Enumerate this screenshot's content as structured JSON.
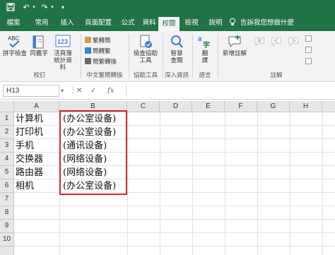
{
  "tabs": [
    "檔案",
    "常用",
    "插入",
    "頁面配置",
    "公式",
    "資料",
    "校閱",
    "檢視",
    "說明"
  ],
  "tell_me": "告訴我您想做什麼",
  "ribbon": {
    "proofing": {
      "spelling": "拼字檢查",
      "thesaurus": "同義字",
      "workbook_stats": "活頁簿統計資料",
      "label": "校訂"
    },
    "chinese": {
      "trad_to_simp": "繁轉簡",
      "simp_to_trad": "簡轉繁",
      "convert": "簡繁轉換",
      "label": "中文繁簡轉換"
    },
    "accessibility": {
      "check": "檢查協助工具",
      "label": "協助工具"
    },
    "insights": {
      "smart_lookup": "智慧查閱",
      "label": "深入資訊"
    },
    "language": {
      "translate": "翻譯",
      "label": "語言"
    },
    "comments": {
      "new_comment": "新增註解",
      "label": "註解"
    }
  },
  "formula_bar": {
    "name_box": "H13",
    "fx": "fx"
  },
  "columns": [
    "A",
    "B",
    "C",
    "D",
    "E",
    "F",
    "G",
    "H"
  ],
  "rows": [
    "1",
    "2",
    "3",
    "4",
    "5",
    "6",
    "7",
    "8",
    "9",
    "10"
  ],
  "cells": [
    {
      "a": "计算机",
      "b": "(办公室设备)"
    },
    {
      "a": "打印机",
      "b": "(办公室设备)"
    },
    {
      "a": "手机",
      "b": "(通讯设备)"
    },
    {
      "a": "交换器",
      "b": "(网络设备)"
    },
    {
      "a": "路由器",
      "b": "(网络设备)"
    },
    {
      "a": "相机",
      "b": "(办公室设备)"
    }
  ],
  "colors": {
    "excel_green": "#217346",
    "highlight_red": "#d92727"
  }
}
